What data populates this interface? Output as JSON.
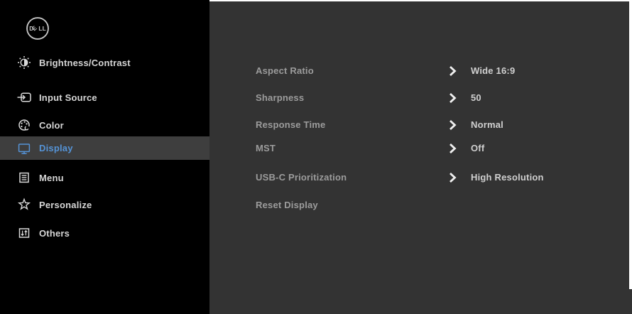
{
  "brand": {
    "logo_text": "DELL"
  },
  "colors": {
    "sidebar_bg": "#000000",
    "panel_bg": "#333333",
    "highlight_bg": "#3e3e3e",
    "accent_blue": "#5593d6",
    "sidebar_text": "#d6d6d6",
    "panel_label_text": "#9c9c9c",
    "value_text": "#d0d0d0",
    "chevron": "#f0f0f0"
  },
  "sidebar": {
    "items": [
      {
        "label": "Brightness/Contrast",
        "icon": "brightness-contrast-icon",
        "selected": false
      },
      {
        "label": "Input Source",
        "icon": "input-source-icon",
        "selected": false
      },
      {
        "label": "Color",
        "icon": "color-palette-icon",
        "selected": false
      },
      {
        "label": "Display",
        "icon": "display-monitor-icon",
        "selected": true
      },
      {
        "label": "Menu",
        "icon": "menu-icon",
        "selected": false
      },
      {
        "label": "Personalize",
        "icon": "star-icon",
        "selected": false
      },
      {
        "label": "Others",
        "icon": "others-icon",
        "selected": false
      }
    ]
  },
  "settings": {
    "rows": [
      {
        "label": "Aspect Ratio",
        "value": "Wide 16:9",
        "has_submenu": true
      },
      {
        "label": "Sharpness",
        "value": "50",
        "has_submenu": true
      },
      {
        "label": "Response Time",
        "value": "Normal",
        "has_submenu": true
      },
      {
        "label": "MST",
        "value": "Off",
        "has_submenu": true
      },
      {
        "label": "USB-C Prioritization",
        "value": "High Resolution",
        "has_submenu": true
      },
      {
        "label": "Reset Display",
        "value": "",
        "has_submenu": false
      }
    ]
  }
}
